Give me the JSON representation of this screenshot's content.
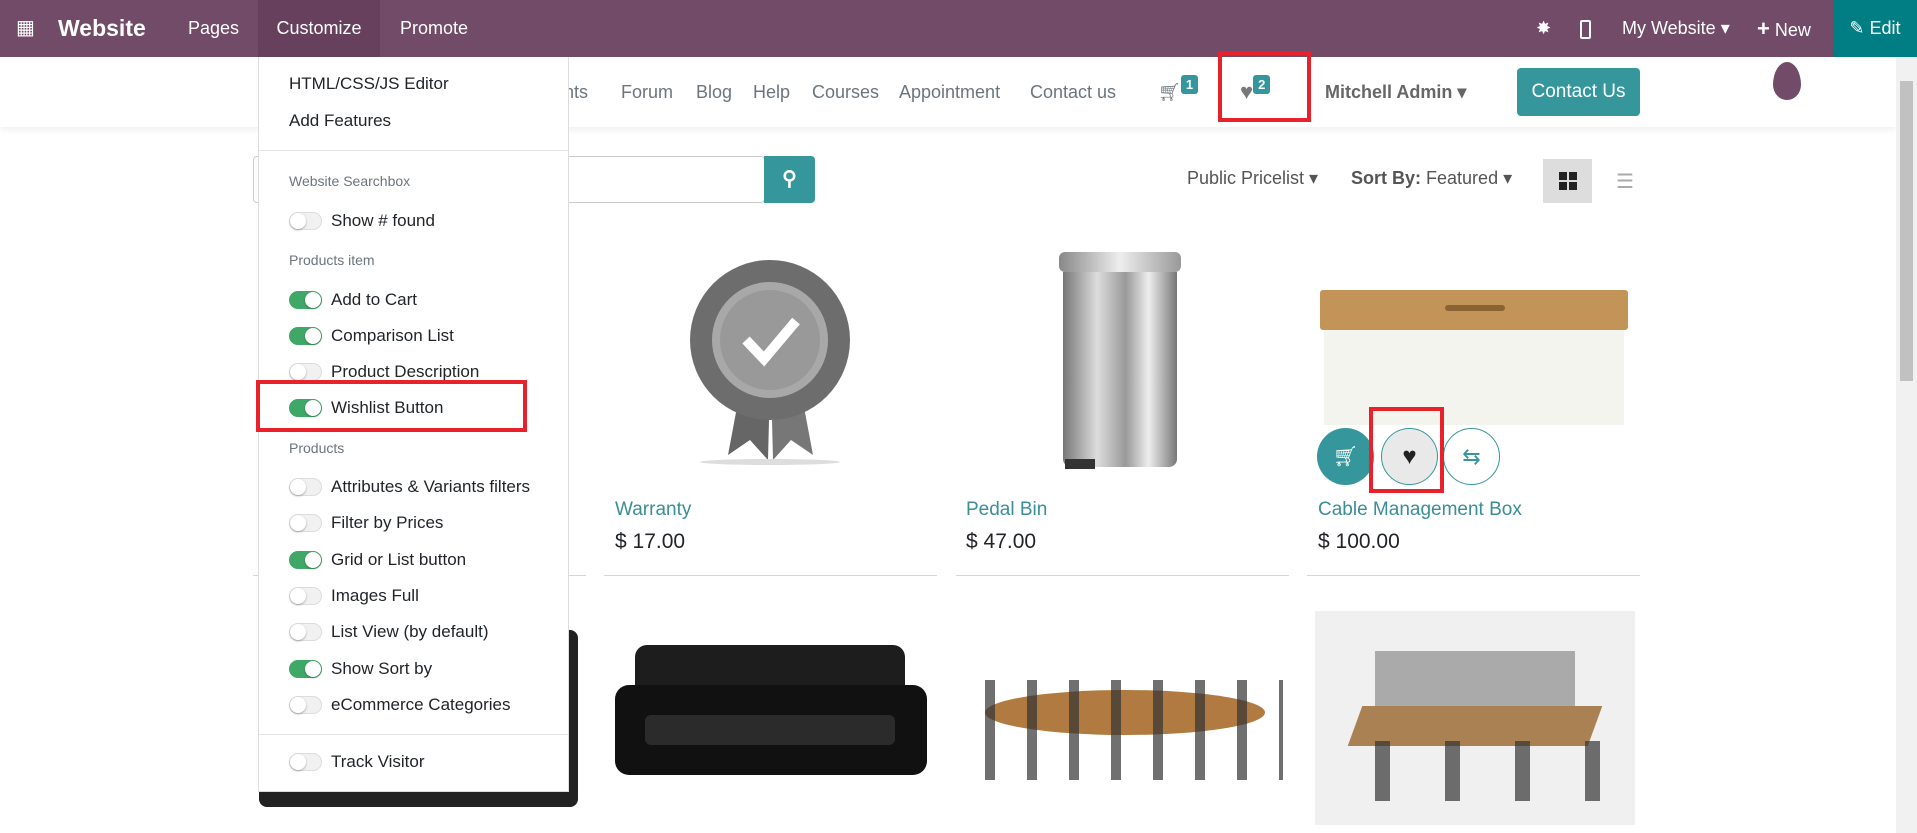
{
  "topbar": {
    "app": "Website",
    "menus": [
      "Pages",
      "Customize",
      "Promote"
    ],
    "site": "My Website",
    "new": "New",
    "edit": "Edit",
    "color": "#714b67"
  },
  "nav": {
    "items": [
      "ents",
      "Forum",
      "Blog",
      "Help",
      "Courses",
      "Appointment",
      "Contact us"
    ],
    "cart_count": "1",
    "wishlist_count": "2",
    "user": "Mitchell Admin",
    "contact_button": "Contact Us"
  },
  "toolbar": {
    "pricelist": "Public Pricelist",
    "sort_label": "Sort By:",
    "sort_value": "Featured"
  },
  "dropdown": {
    "actions": [
      "HTML/CSS/JS Editor",
      "Add Features"
    ],
    "sections": [
      {
        "title": "Website Searchbox",
        "options": [
          {
            "label": "Show # found",
            "on": false
          }
        ]
      },
      {
        "title": "Products item",
        "options": [
          {
            "label": "Add to Cart",
            "on": true
          },
          {
            "label": "Comparison List",
            "on": true
          },
          {
            "label": "Product Description",
            "on": false
          },
          {
            "label": "Wishlist Button",
            "on": true
          }
        ]
      },
      {
        "title": "Products",
        "options": [
          {
            "label": "Attributes & Variants filters",
            "on": false
          },
          {
            "label": "Filter by Prices",
            "on": false
          },
          {
            "label": "Grid or List button",
            "on": true
          },
          {
            "label": "Images Full",
            "on": false
          },
          {
            "label": "List View (by default)",
            "on": false
          },
          {
            "label": "Show Sort by",
            "on": true
          },
          {
            "label": "eCommerce Categories",
            "on": false
          }
        ]
      }
    ],
    "track": {
      "label": "Track Visitor",
      "on": false
    }
  },
  "products": [
    {
      "name": "Warranty",
      "price": "$ 17.00"
    },
    {
      "name": "Pedal Bin",
      "price": "$ 47.00"
    },
    {
      "name": "Cable Management Box",
      "price": "$ 100.00"
    }
  ],
  "accent": "#35979c"
}
